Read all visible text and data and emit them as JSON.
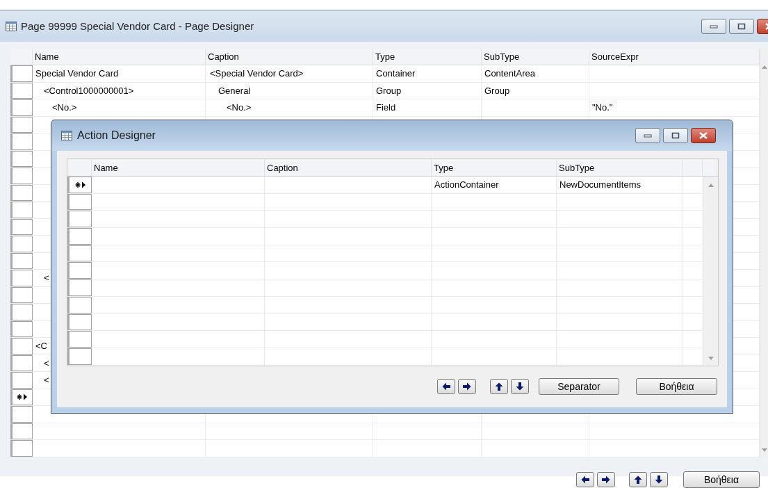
{
  "window": {
    "title": "Page 99999 Special Vendor Card - Page Designer"
  },
  "table": {
    "columns": [
      "Name",
      "Caption",
      "Type",
      "SubType",
      "SourceExpr"
    ],
    "rows": [
      {
        "kind": "item",
        "name": "Special Vendor Card",
        "caption": "<Special Vendor Card>",
        "type": "Container",
        "subtype": "ContentArea",
        "children": [
          {
            "kind": "item",
            "name": "<Control1000000001>",
            "caption": "General",
            "type": "Group",
            "subtype": "Group",
            "children": [
              {
                "kind": "item",
                "name": "<No.>",
                "caption": "<No.>",
                "type": "Field",
                "source_expr": "\"No.\""
              },
              {
                "kind": "empty"
              },
              {
                "kind": "empty"
              },
              {
                "kind": "empty"
              },
              {
                "kind": "empty"
              },
              {
                "kind": "empty"
              },
              {
                "kind": "empty"
              },
              {
                "kind": "empty"
              },
              {
                "kind": "empty"
              },
              {
                "kind": "empty"
              }
            ]
          },
          {
            "kind": "item",
            "name": "<"
          },
          {
            "kind": "empty"
          },
          {
            "kind": "empty"
          },
          {
            "kind": "empty"
          }
        ]
      },
      {
        "kind": "item",
        "name": "<C",
        "children": [
          {
            "kind": "item",
            "name": "<"
          },
          {
            "kind": "item",
            "name": "<"
          }
        ]
      },
      {
        "kind": "new_row"
      },
      {
        "kind": "empty"
      },
      {
        "kind": "empty"
      },
      {
        "kind": "empty"
      }
    ]
  },
  "help_button": "Βοήθεια",
  "dialog": {
    "title": "Action Designer",
    "columns": [
      "Name",
      "Caption",
      "Type",
      "SubType"
    ],
    "rows": [
      {
        "kind": "new_row",
        "type": "ActionContainer",
        "subtype": "NewDocumentItems"
      },
      {
        "kind": "empty"
      },
      {
        "kind": "empty"
      },
      {
        "kind": "empty"
      },
      {
        "kind": "empty"
      },
      {
        "kind": "empty"
      },
      {
        "kind": "empty"
      },
      {
        "kind": "empty"
      },
      {
        "kind": "empty"
      },
      {
        "kind": "empty"
      },
      {
        "kind": "empty"
      }
    ],
    "separator_button": "Separator",
    "help_button": "Βοήθεια"
  }
}
